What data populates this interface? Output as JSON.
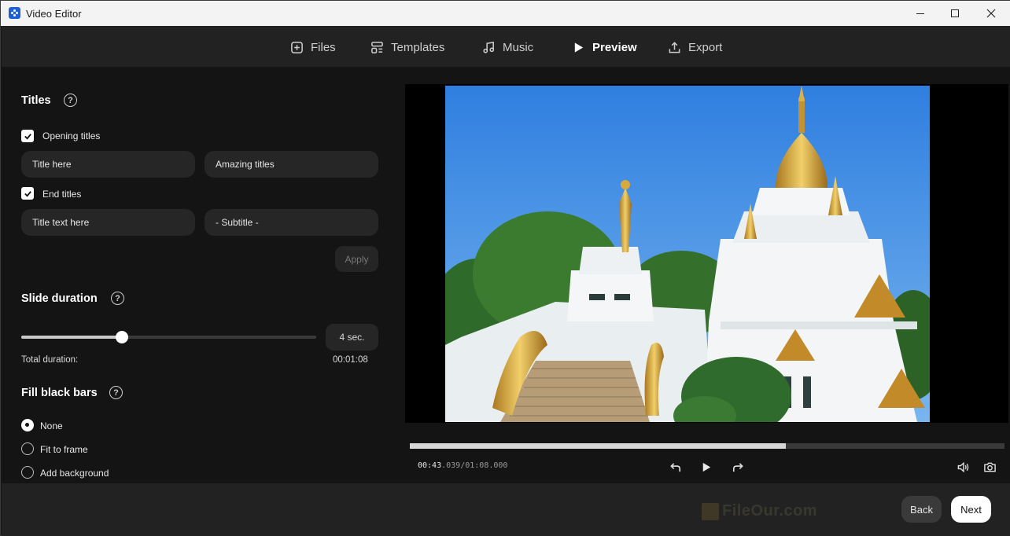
{
  "window": {
    "title": "Video Editor"
  },
  "nav": {
    "items": [
      {
        "label": "Files",
        "icon": "add-file-icon"
      },
      {
        "label": "Templates",
        "icon": "templates-icon"
      },
      {
        "label": "Music",
        "icon": "music-note-icon"
      },
      {
        "label": "Preview",
        "icon": "play-icon",
        "active": true
      },
      {
        "label": "Export",
        "icon": "export-icon"
      }
    ]
  },
  "titles": {
    "heading": "Titles",
    "opening": {
      "label": "Opening titles",
      "checked": true,
      "title": "Title here",
      "subtitle": "Amazing titles"
    },
    "end": {
      "label": "End titles",
      "checked": true,
      "title": "Title text here",
      "subtitle": "- Subtitle -"
    },
    "apply_label": "Apply"
  },
  "slide_duration": {
    "heading": "Slide duration",
    "value_label": "4 sec.",
    "slider_fraction": 0.34,
    "total_label": "Total duration:",
    "total_value": "00:01:08"
  },
  "fill_black_bars": {
    "heading": "Fill black bars",
    "options": [
      {
        "label": "None",
        "selected": true
      },
      {
        "label": "Fit to frame",
        "selected": false
      },
      {
        "label": "Add background",
        "selected": false
      }
    ]
  },
  "player": {
    "time_current_bright": "00:43",
    "time_current_dim": ".039",
    "time_separator": "/",
    "time_total": "01:08.000",
    "progress_fraction": 0.632
  },
  "footer": {
    "back_label": "Back",
    "next_label": "Next",
    "watermark": "FileOur.com"
  },
  "colors": {
    "accent": "#1c5fd6",
    "background": "#141414",
    "toolbar": "#222222"
  }
}
